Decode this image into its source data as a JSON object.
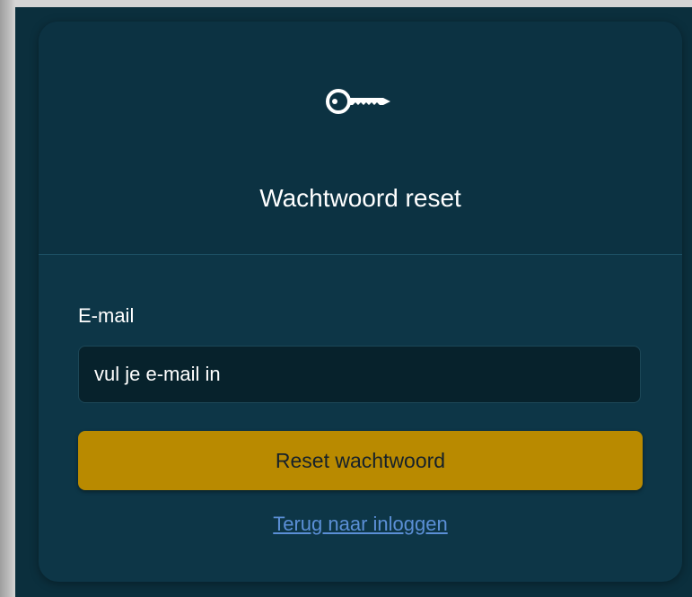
{
  "colors": {
    "page_background": "#0b2f3d",
    "card_background": "#0d3647",
    "input_background": "#07222c",
    "button_background": "#b98a00",
    "link_color": "#5b8fd6",
    "text_color": "#ffffff"
  },
  "header": {
    "icon": "key-icon",
    "title": "Wachtwoord reset"
  },
  "form": {
    "email_label": "E-mail",
    "email_placeholder": "vul je e-mail in",
    "email_value": "",
    "submit_label": "Reset wachtwoord",
    "back_link_label": "Terug naar inloggen"
  }
}
